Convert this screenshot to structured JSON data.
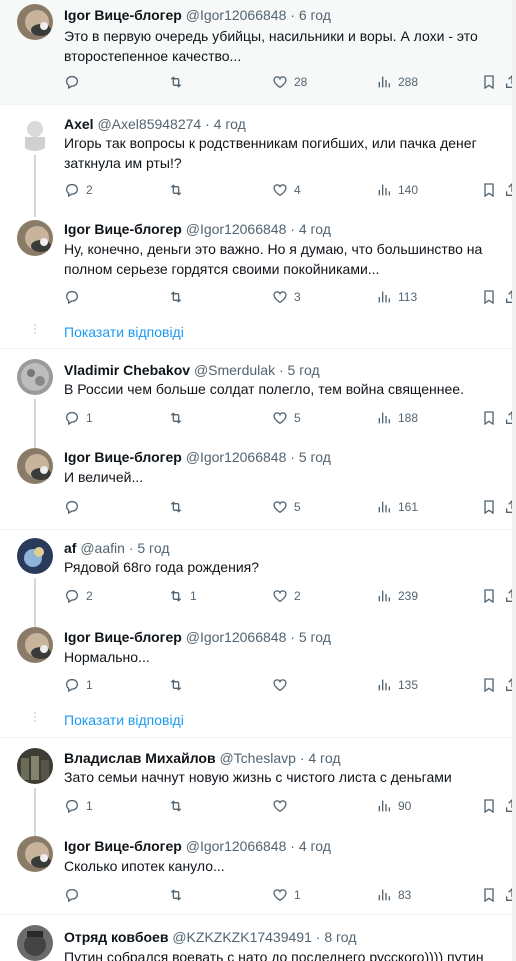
{
  "tweets": [
    {
      "name": "Igor Вице-блогер",
      "handle": "@Igor12066848",
      "time": "6 год",
      "text": "Это в первую очередь убийцы, насильники и воры. А лохи - это второстепенное качество...",
      "replies": "",
      "retweets": "",
      "likes": "28",
      "views": "288"
    },
    {
      "name": "Axel",
      "handle": "@Axel85948274",
      "time": "4 год",
      "text": "Игорь так вопросы к родственникам погибших, или пачка денег заткнула им рты!?",
      "replies": "2",
      "retweets": "",
      "likes": "4",
      "views": "140"
    },
    {
      "name": "Igor Вице-блогер",
      "handle": "@Igor12066848",
      "time": "4 год",
      "text": "Ну, конечно, деньги это важно. Но я думаю, что большинство на полном серьезе гордятся своими покойниками...",
      "replies": "",
      "retweets": "",
      "likes": "3",
      "views": "113"
    },
    {
      "name": "Vladimir Chebakov",
      "handle": "@Smerdulak",
      "time": "5 год",
      "text": "В России чем больше солдат полегло, тем война священнее.",
      "replies": "1",
      "retweets": "",
      "likes": "5",
      "views": "188"
    },
    {
      "name": "Igor Вице-блогер",
      "handle": "@Igor12066848",
      "time": "5 год",
      "text": "И величей...",
      "replies": "",
      "retweets": "",
      "likes": "5",
      "views": "161"
    },
    {
      "name": "af",
      "handle": "@aafin",
      "time": "5 год",
      "text": "Рядовой 68го года рождения?",
      "replies": "2",
      "retweets": "1",
      "likes": "2",
      "views": "239"
    },
    {
      "name": "Igor Вице-блогер",
      "handle": "@Igor12066848",
      "time": "5 год",
      "text": "Нормально...",
      "replies": "1",
      "retweets": "",
      "likes": "",
      "views": "135"
    },
    {
      "name": "Владислав Михайлов",
      "handle": "@Tcheslavp",
      "time": "4 год",
      "text": "Зато семьи начнут новую жизнь  с чистого листа с деньгами",
      "replies": "1",
      "retweets": "",
      "likes": "",
      "views": "90"
    },
    {
      "name": "Igor Вице-блогер",
      "handle": "@Igor12066848",
      "time": "4 год",
      "text": "Сколько ипотек кануло...",
      "replies": "",
      "retweets": "",
      "likes": "1",
      "views": "83"
    },
    {
      "name": "Отряд ковбоев",
      "handle": "@KZKZKZK17439491",
      "time": "8 год",
      "text": "Путин собрался воевать с нато до последнего русского)))) путин",
      "replies": "",
      "retweets": "",
      "likes": "",
      "views": ""
    }
  ],
  "show_replies_label": "Показати відповіді",
  "separator": "·",
  "colors": {
    "accent": "#1d9bf0",
    "muted": "#536471",
    "divider": "#eff3f4",
    "line": "#cfd9de"
  }
}
